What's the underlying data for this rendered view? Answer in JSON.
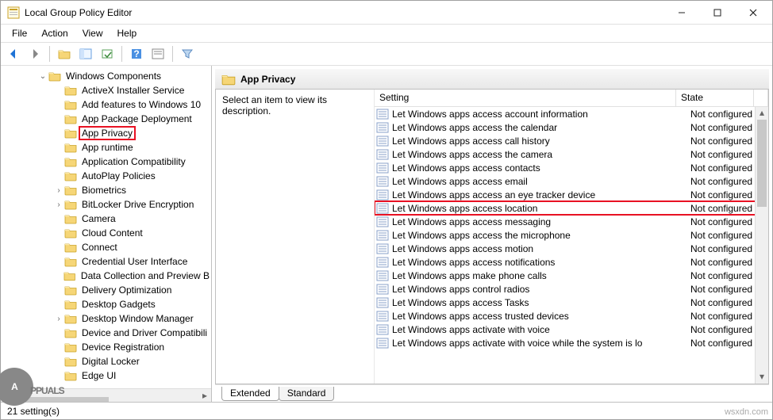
{
  "window": {
    "title": "Local Group Policy Editor"
  },
  "menu": [
    "File",
    "Action",
    "View",
    "Help"
  ],
  "tree": {
    "root_label": "Windows Components",
    "items": [
      {
        "label": "ActiveX Installer Service",
        "expand": ""
      },
      {
        "label": "Add features to Windows 10",
        "expand": ""
      },
      {
        "label": "App Package Deployment",
        "expand": ""
      },
      {
        "label": "App Privacy",
        "expand": "",
        "selected": true
      },
      {
        "label": "App runtime",
        "expand": ""
      },
      {
        "label": "Application Compatibility",
        "expand": ""
      },
      {
        "label": "AutoPlay Policies",
        "expand": ""
      },
      {
        "label": "Biometrics",
        "expand": ">"
      },
      {
        "label": "BitLocker Drive Encryption",
        "expand": ">"
      },
      {
        "label": "Camera",
        "expand": ""
      },
      {
        "label": "Cloud Content",
        "expand": ""
      },
      {
        "label": "Connect",
        "expand": ""
      },
      {
        "label": "Credential User Interface",
        "expand": ""
      },
      {
        "label": "Data Collection and Preview B",
        "expand": ""
      },
      {
        "label": "Delivery Optimization",
        "expand": ""
      },
      {
        "label": "Desktop Gadgets",
        "expand": ""
      },
      {
        "label": "Desktop Window Manager",
        "expand": ">"
      },
      {
        "label": "Device and Driver Compatibili",
        "expand": ""
      },
      {
        "label": "Device Registration",
        "expand": ""
      },
      {
        "label": "Digital Locker",
        "expand": ""
      },
      {
        "label": "Edge UI",
        "expand": ""
      }
    ]
  },
  "content": {
    "header": "App Privacy",
    "description_prompt": "Select an item to view its description.",
    "columns": {
      "setting": "Setting",
      "state": "State"
    },
    "settings": [
      {
        "name": "Let Windows apps access account information",
        "state": "Not configured"
      },
      {
        "name": "Let Windows apps access the calendar",
        "state": "Not configured"
      },
      {
        "name": "Let Windows apps access call history",
        "state": "Not configured"
      },
      {
        "name": "Let Windows apps access the camera",
        "state": "Not configured"
      },
      {
        "name": "Let Windows apps access contacts",
        "state": "Not configured"
      },
      {
        "name": "Let Windows apps access email",
        "state": "Not configured"
      },
      {
        "name": "Let Windows apps access an eye tracker device",
        "state": "Not configured"
      },
      {
        "name": "Let Windows apps access location",
        "state": "Not configured",
        "highlight": true
      },
      {
        "name": "Let Windows apps access messaging",
        "state": "Not configured"
      },
      {
        "name": "Let Windows apps access the microphone",
        "state": "Not configured"
      },
      {
        "name": "Let Windows apps access motion",
        "state": "Not configured"
      },
      {
        "name": "Let Windows apps access notifications",
        "state": "Not configured"
      },
      {
        "name": "Let Windows apps make phone calls",
        "state": "Not configured"
      },
      {
        "name": "Let Windows apps control radios",
        "state": "Not configured"
      },
      {
        "name": "Let Windows apps access Tasks",
        "state": "Not configured"
      },
      {
        "name": "Let Windows apps access trusted devices",
        "state": "Not configured"
      },
      {
        "name": "Let Windows apps activate with voice",
        "state": "Not configured"
      },
      {
        "name": "Let Windows apps activate with voice while the system is lo",
        "state": "Not configured"
      }
    ]
  },
  "tabs": {
    "extended": "Extended",
    "standard": "Standard"
  },
  "status": {
    "text": "21 setting(s)"
  },
  "watermark": {
    "brand": "PPUALS",
    "badge": "A"
  },
  "source": "wsxdn.com"
}
